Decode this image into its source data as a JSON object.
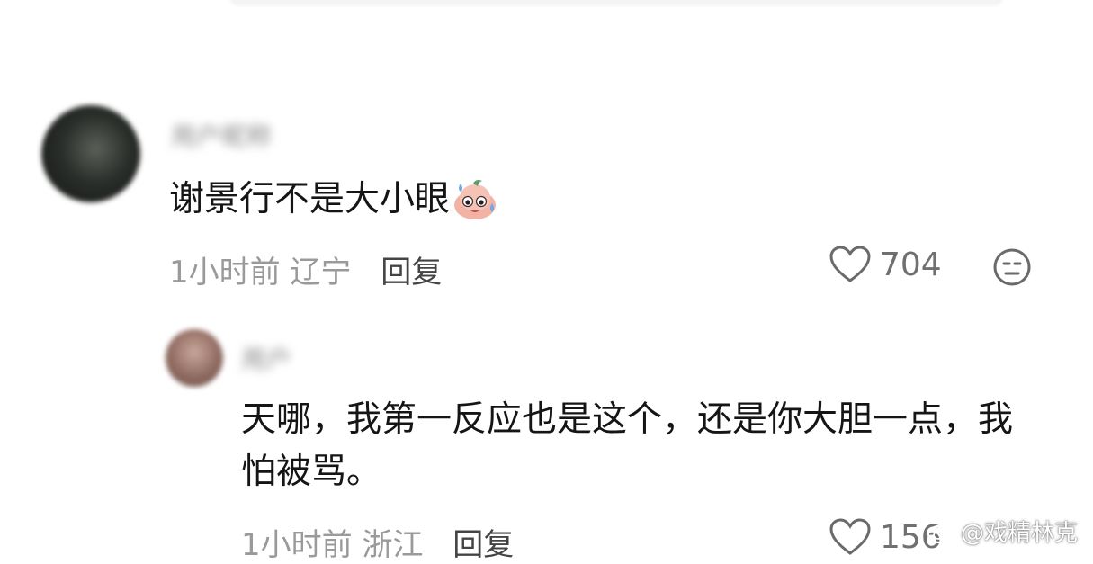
{
  "comments": [
    {
      "username": "用户昵称",
      "text": "谢景行不是大小眼",
      "emoji": "sweating-face-emoji",
      "time": "1小时前",
      "location": "辽宁",
      "reply_label": "回复",
      "likes": "704"
    },
    {
      "username": "用户",
      "text": "天哪，我第一反应也是这个，还是你大胆一点，我怕被骂。",
      "time": "1小时前",
      "location": "浙江",
      "reply_label": "回复",
      "likes": "156"
    }
  ],
  "icons": {
    "like": "heart-icon",
    "dislike": "meh-face-icon"
  },
  "watermark": {
    "text": "@戏精林克"
  },
  "colors": {
    "text": "#151515",
    "meta": "#9a9a9a",
    "reply": "#444444"
  }
}
